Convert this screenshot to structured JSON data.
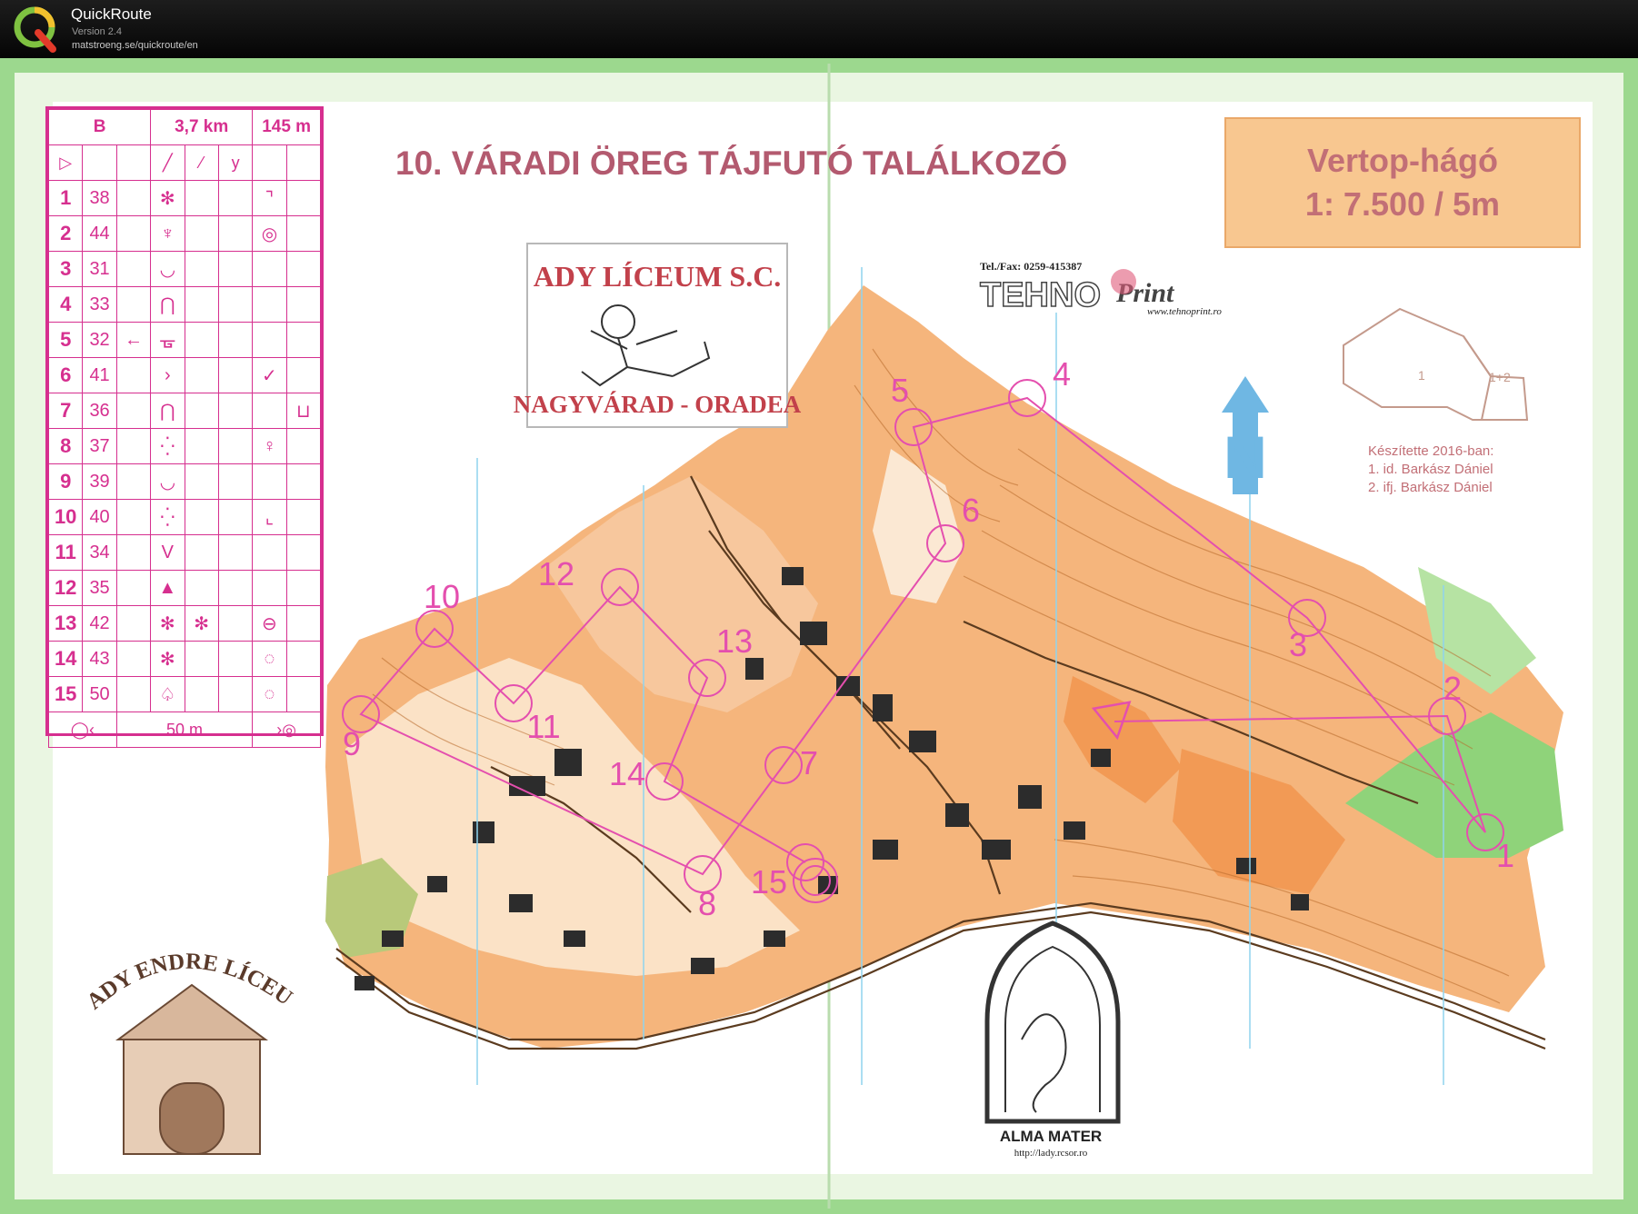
{
  "app": {
    "name": "QuickRoute",
    "version": "Version 2.4",
    "url": "matstroeng.se/quickroute/en",
    "logo_letter": "Q"
  },
  "map": {
    "event_title": "10. VÁRADI ÖREG TÁJFUTÓ TALÁLKOZÓ",
    "area_name": "Vertop-hágó",
    "scale": "1: 7.500 / 5m",
    "club_logo": {
      "line1": "ADY LÍCEUM S.C.",
      "line2": "NAGYVÁRAD - ORADEA"
    },
    "sponsor": {
      "contact": "Tel./Fax: 0259-415387",
      "name_part1": "TEHNO",
      "name_part2": "Print",
      "url": "www.tehnoprint.ro"
    },
    "school_logo": "ADY ENDRE LÍCEUM",
    "alma_mater": {
      "name": "ALMA MATER",
      "url": "http://lady.rcsor.ro"
    },
    "inset": {
      "part1": "1",
      "part2": "1+2"
    },
    "credits": {
      "heading": "Készítette 2016-ban:",
      "line1": "1. id. Barkász Dániel",
      "line2": "2. ifj. Barkász Dániel"
    },
    "north_letter": "N",
    "colors": {
      "course": "#e44fae",
      "open": "#f09a48",
      "forest": "#8fd37a",
      "water_line": "#8fd3ee",
      "border": "#9cd88e"
    }
  },
  "description_sheet": {
    "course": "B",
    "length": "3,7 km",
    "climb": "145 m",
    "finish_distance": "50 m",
    "controls": [
      {
        "num": "1",
        "code": "38",
        "d": "✻",
        "g": "⌝"
      },
      {
        "num": "2",
        "code": "44",
        "d": "♆",
        "g": "◎"
      },
      {
        "num": "3",
        "code": "31",
        "d": "◡",
        "g": ""
      },
      {
        "num": "4",
        "code": "33",
        "d": "⋂",
        "g": ""
      },
      {
        "num": "5",
        "code": "32",
        "c": "←",
        "d": "ᚗ",
        "g": ""
      },
      {
        "num": "6",
        "code": "41",
        "d": "›",
        "g": "✓"
      },
      {
        "num": "7",
        "code": "36",
        "d": "⋂",
        "g": "",
        "h": "⊔"
      },
      {
        "num": "8",
        "code": "37",
        "d": "⁛",
        "g": "♀"
      },
      {
        "num": "9",
        "code": "39",
        "d": "◡",
        "g": ""
      },
      {
        "num": "10",
        "code": "40",
        "d": "⁛",
        "g": "⌞"
      },
      {
        "num": "11",
        "code": "34",
        "d": "V",
        "g": ""
      },
      {
        "num": "12",
        "code": "35",
        "d": "▲",
        "g": ""
      },
      {
        "num": "13",
        "code": "42",
        "d": "✻",
        "e": "✻",
        "g": "⊖"
      },
      {
        "num": "14",
        "code": "43",
        "d": "✻",
        "g": "◌"
      },
      {
        "num": "15",
        "code": "50",
        "d": "♤",
        "g": "◌"
      }
    ]
  },
  "course_controls": [
    {
      "label": "1"
    },
    {
      "label": "2"
    },
    {
      "label": "3"
    },
    {
      "label": "4"
    },
    {
      "label": "5"
    },
    {
      "label": "6"
    },
    {
      "label": "7"
    },
    {
      "label": "8"
    },
    {
      "label": "9"
    },
    {
      "label": "10"
    },
    {
      "label": "11"
    },
    {
      "label": "12"
    },
    {
      "label": "13"
    },
    {
      "label": "14"
    },
    {
      "label": "15"
    }
  ]
}
